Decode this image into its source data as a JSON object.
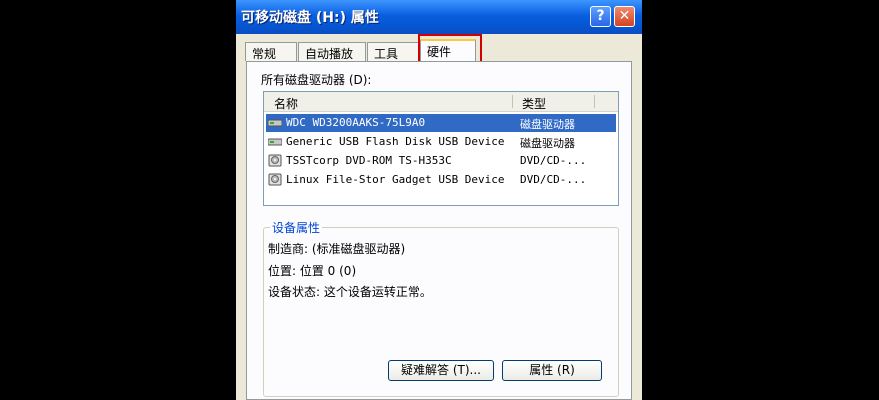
{
  "window": {
    "title": "可移动磁盘 (H:) 属性",
    "help_label": "?",
    "close_label": "✕"
  },
  "tabs": [
    {
      "label": "常规"
    },
    {
      "label": "自动播放"
    },
    {
      "label": "工具"
    },
    {
      "label": "硬件",
      "active": true
    }
  ],
  "drives_label": "所有磁盘驱动器 (D):",
  "list": {
    "columns": [
      "名称",
      "类型"
    ],
    "rows": [
      {
        "name": "WDC WD3200AAKS-75L9A0",
        "type": "磁盘驱动器",
        "icon": "hard-disk-icon",
        "selected": true
      },
      {
        "name": "Generic USB Flash Disk USB Device",
        "type": "磁盘驱动器",
        "icon": "hard-disk-icon",
        "selected": false
      },
      {
        "name": "TSSTcorp DVD-ROM TS-H353C",
        "type": "DVD/CD-...",
        "icon": "optical-drive-icon",
        "selected": false
      },
      {
        "name": "Linux File-Stor Gadget USB Device",
        "type": "DVD/CD-...",
        "icon": "optical-drive-icon",
        "selected": false
      }
    ]
  },
  "properties": {
    "title": "设备属性",
    "manufacturer": "制造商: (标准磁盘驱动器)",
    "location": "位置: 位置 0 (0)",
    "status": "设备状态: 这个设备运转正常。"
  },
  "buttons": {
    "troubleshoot": "疑难解答 (T)...",
    "properties": "属性 (R)"
  },
  "colors": {
    "selection": "#316ac5",
    "highlight_box": "#d20000",
    "titlebar": "#0558d6"
  }
}
